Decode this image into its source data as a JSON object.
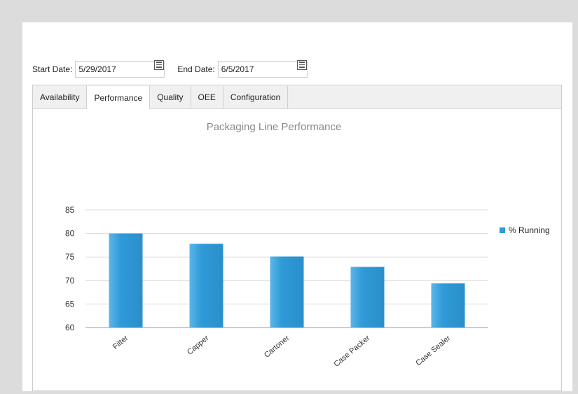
{
  "dates": {
    "start_label": "Start Date:",
    "start_value": "5/29/2017",
    "end_label": "End Date:",
    "end_value": "6/5/2017",
    "calendar_icon": "calendar-icon"
  },
  "tabs": [
    {
      "label": "Availability"
    },
    {
      "label": "Performance",
      "active": true
    },
    {
      "label": "Quality"
    },
    {
      "label": "OEE"
    },
    {
      "label": "Configuration"
    }
  ],
  "chart_data": {
    "type": "bar",
    "title": "Packaging Line Performance",
    "categories": [
      "Filter",
      "Capper",
      "Cartoner",
      "Case Packer",
      "Case Sealer"
    ],
    "series": [
      {
        "name": "% Running",
        "values": [
          80.0,
          77.8,
          75.1,
          72.9,
          69.4
        ],
        "color": "#2e9ad7"
      }
    ],
    "yticks": [
      60,
      65,
      70,
      75,
      80,
      85
    ],
    "ylim": [
      60,
      85
    ],
    "grid": true,
    "legend": "right"
  }
}
